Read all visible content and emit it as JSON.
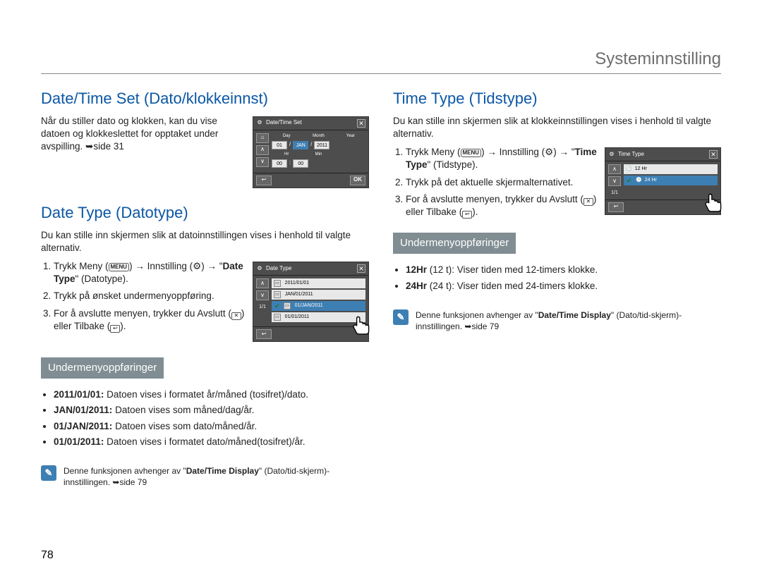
{
  "header": {
    "title": "Systeminnstilling"
  },
  "page_number": "78",
  "left": {
    "section1": {
      "title": "Date/Time Set (Dato/klokkeinnst)",
      "text_a": "Når du stiller dato og klokken, kan du vise datoen og klokkeslettet for opptaket under avspilling. ",
      "text_b": "side 31",
      "device": {
        "head": "Date/Time Set",
        "labels": {
          "day": "Day",
          "month": "Month",
          "year": "Year",
          "hr": "Hr",
          "min": "Min"
        },
        "values": {
          "day": "01",
          "month": "JAN",
          "year": "2011",
          "hr": "00",
          "min": "00"
        },
        "ok": "OK"
      }
    },
    "section2": {
      "title": "Date Type (Datotype)",
      "intro": "Du kan stille inn skjermen slik at datoinnstillingen vises i henhold til valgte alternativ.",
      "steps": {
        "s1a": "Trykk Meny (",
        "s1b": ") ",
        "s1c": " Innstilling (",
        "s1d": ") ",
        "s1e": " \"",
        "s1f": "Date Type",
        "s1g": "\" (Datotype).",
        "s2": "Trykk på ønsket undermenyoppføring.",
        "s3a": "For å avslutte menyen, trykker du Avslutt (",
        "s3b": ") eller Tilbake (",
        "s3c": ")."
      },
      "device": {
        "head": "Date Type",
        "pg": "1/1",
        "items": [
          "2011/01/01",
          "JAN/01/2011",
          "01/JAN/2011",
          "01/01/2011"
        ]
      },
      "sub_head": "Undermenyoppføringer",
      "bullets": {
        "b1a": "2011/01/01:",
        "b1b": " Datoen vises i formatet år/måned (tosifret)/dato.",
        "b2a": "JAN/01/2011:",
        "b2b": " Datoen vises som måned/dag/år.",
        "b3a": "01/JAN/2011:",
        "b3b": " Datoen vises som dato/måned/år.",
        "b4a": "01/01/2011:",
        "b4b": " Datoen vises i formatet dato/måned(tosifret)/år."
      },
      "note_a": "Denne funksjonen avhenger av \"",
      "note_b": "Date/Time Display",
      "note_c": "\" (Dato/tid-skjerm)-innstillingen. ",
      "note_d": "side 79"
    }
  },
  "right": {
    "section1": {
      "title": "Time Type (Tidstype)",
      "intro": "Du kan stille inn skjermen slik at klokkeinnstillingen vises i henhold til valgte alternativ.",
      "steps": {
        "s1a": "Trykk Meny (",
        "s1b": ") ",
        "s1c": " Innstilling (",
        "s1d": ") ",
        "s1e": " \"",
        "s1f": "Time Type",
        "s1g": "\" (Tidstype).",
        "s2": "Trykk på det aktuelle skjermalternativet.",
        "s3a": "For å avslutte menyen, trykker du Avslutt (",
        "s3b": ") eller Tilbake (",
        "s3c": ")."
      },
      "device": {
        "head": "Time Type",
        "pg": "1/1",
        "items": [
          "12 Hr",
          "24 Hr"
        ]
      },
      "sub_head": "Undermenyoppføringer",
      "bullets": {
        "b1a": "12Hr",
        "b1b": " (12 t): Viser tiden med 12-timers klokke.",
        "b2a": "24Hr",
        "b2b": " (24 t): Viser tiden med 24-timers klokke."
      },
      "note_a": "Denne funksjonen avhenger av \"",
      "note_b": "Date/Time Display",
      "note_c": "\" (Dato/tid-skjerm)-innstillingen. ",
      "note_d": "side 79"
    }
  },
  "icons": {
    "menu": "MENU",
    "gear": "⚙",
    "close_x": "✕",
    "back": "↩",
    "check": "✔",
    "clock": "🕑"
  }
}
